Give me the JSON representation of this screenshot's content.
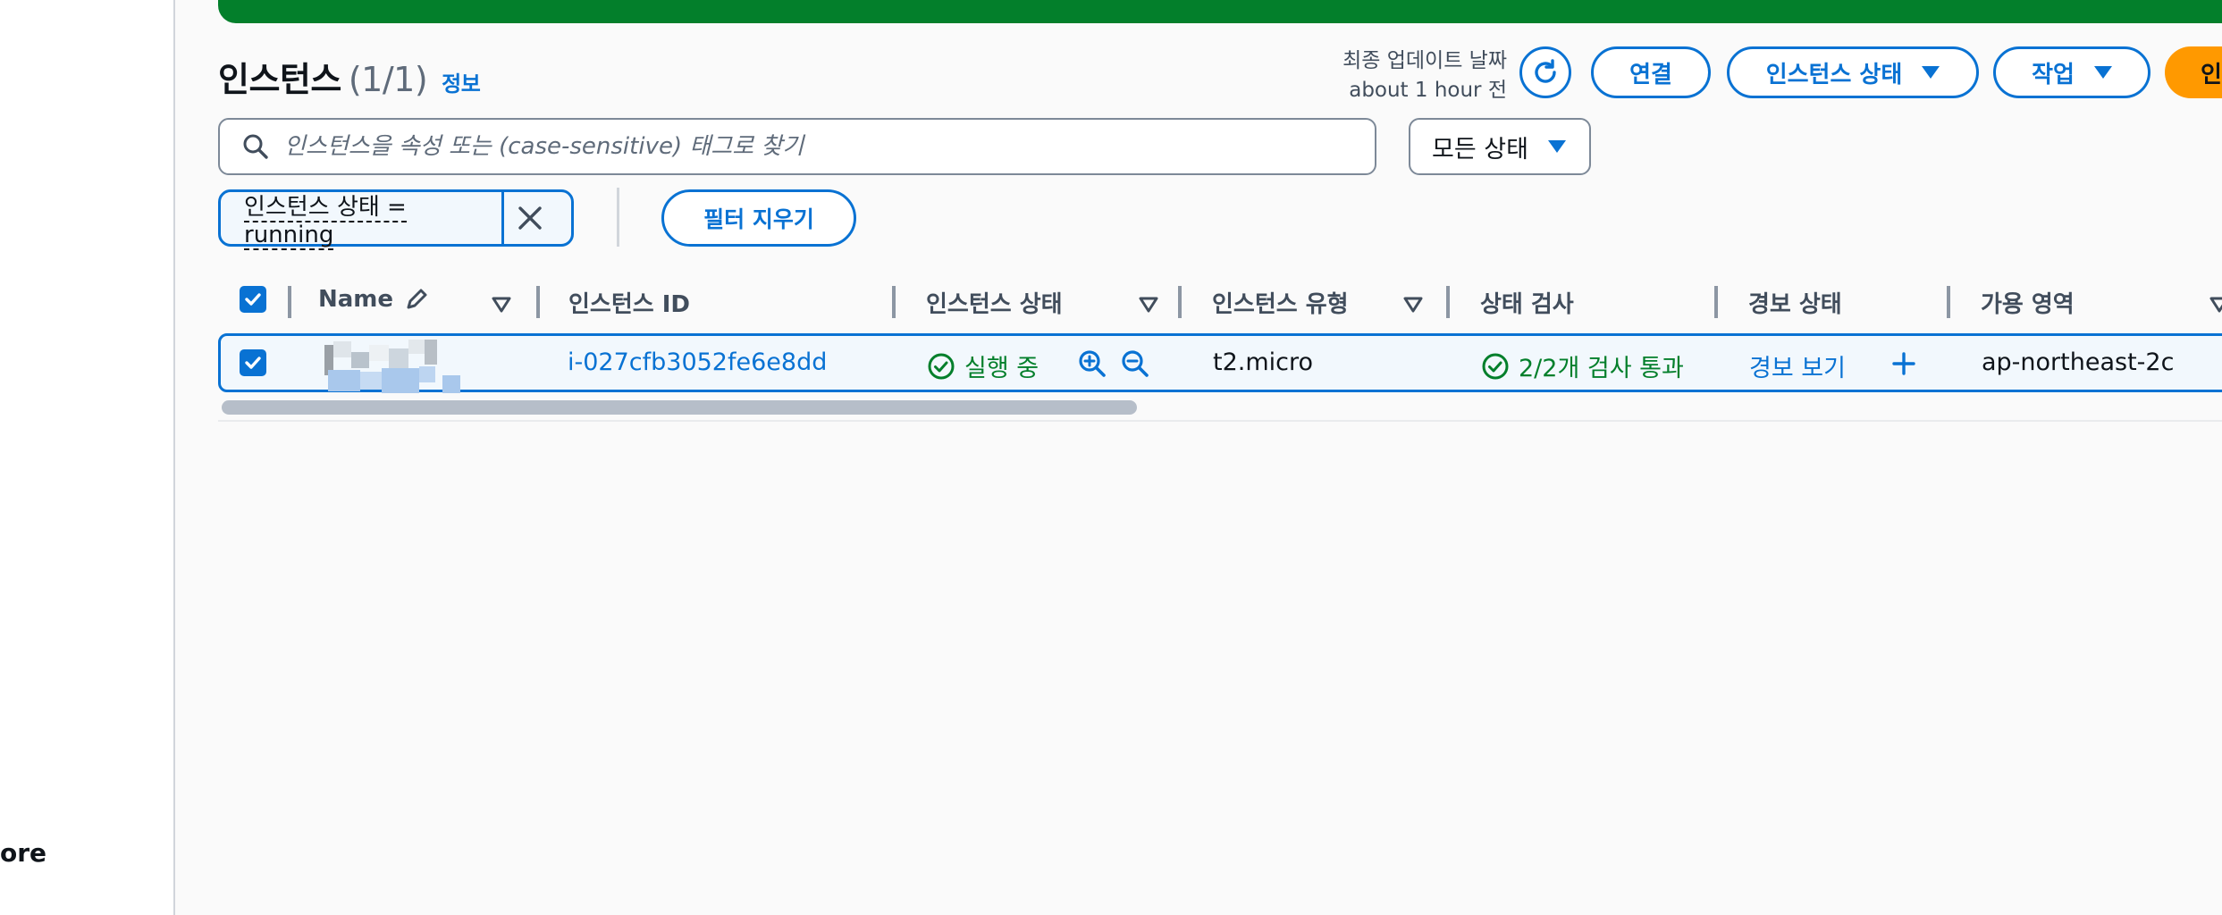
{
  "leftnav": {
    "more_label": "ore"
  },
  "header": {
    "title": "인스턴스",
    "count": "(1/1)",
    "info_link": "정보",
    "last_updated_label": "최종 업데이트 날짜",
    "last_updated_value": "about 1 hour 전",
    "buttons": {
      "connect": "연결",
      "instance_state": "인스턴스 상태",
      "actions": "작업",
      "launch": "인"
    }
  },
  "search": {
    "placeholder": "인스턴스을 속성 또는 (case-sensitive) 태그로 찾기",
    "value": ""
  },
  "state_filter": {
    "selected": "모든 상태"
  },
  "filter_token": {
    "label": "인스턴스 상태 = running"
  },
  "clear_filters_label": "필터 지우기",
  "table": {
    "columns": [
      "Name",
      "인스턴스 ID",
      "인스턴스 상태",
      "인스턴스 유형",
      "상태 검사",
      "경보 상태",
      "가용 영역"
    ],
    "rows": [
      {
        "selected": true,
        "name": "",
        "instance_id": "i-027cfb3052fe6e8dd",
        "state": "실행 중",
        "type": "t2.micro",
        "status_check": "2/2개 검사 통과",
        "alarm": "경보 보기",
        "az": "ap-northeast-2c"
      }
    ]
  },
  "colors": {
    "accent": "#0972d3",
    "success": "#037f2b",
    "primary": "#ff9900",
    "banner": "#037f2b"
  }
}
